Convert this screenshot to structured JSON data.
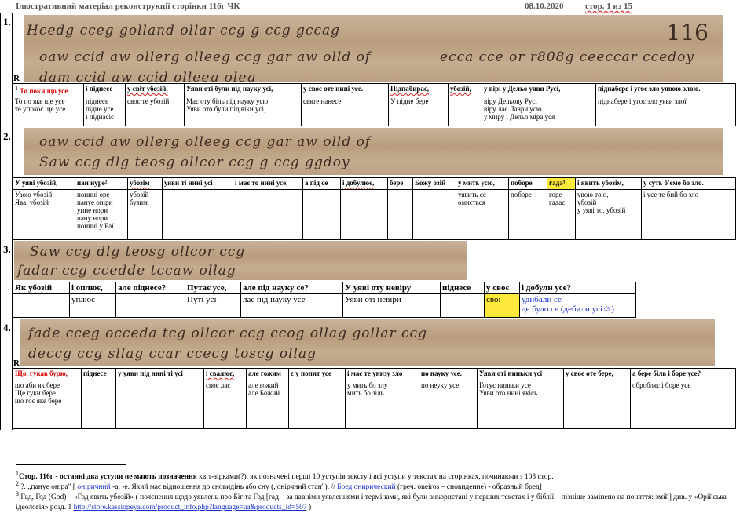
{
  "header": {
    "title": "Ілюстративний матеріал  реконструкції сторінки 116г ЧК",
    "date": "08.10.2020",
    "page": "стор. 1 из 15"
  },
  "section1": {
    "num": "1.",
    "r": "R",
    "ink1": "Hcedg cceg golland ollar ccg g ccg gccag",
    "ink2": "oaw ccid aw ollerg olleeg ccg gar aw olld of",
    "ink3": "dam ccid aw ccid olleeg oleg",
    "pagenum": "116",
    "ink_right": "ecca cce or r808g ceeccar ccedoy",
    "headers": [
      "То поки що усе",
      "і піднесе",
      "у світ убозій,",
      "Уяви оті були під науку усі,",
      "у своє оте нині усе.",
      "Підпабирає,",
      "убозій,",
      "у вірі у Дельо уяви Русі,",
      "піднабере і угоє зло уявою злою."
    ],
    "cells": [
      "То по яке ще усе\nте упокоє ще усе",
      "піднесе\nпідне усе\nі піднасіє",
      "своє те убозій",
      "Має оту біль під науку усю\nУяви ото були під віки усі,",
      "святе нанесе",
      "У підне бере",
      "",
      "віру Дельову Русі\nвіру лає Лаври усю\nу миру і Дельо міра уся",
      "піднабере і угоє зло уяви злої"
    ]
  },
  "section2": {
    "num": "2.",
    "ink1": "oaw ccid aw ollerg olleeg ccg gar aw olld of",
    "ink2": "Saw ccg dlg teosg ollcor ccg g ccg ggdoy",
    "headers": [
      "У уяві убозій,",
      "пан нуре²",
      "убозім",
      "уяви ті нині усі",
      "і має то нині усе,",
      "а під се",
      "і добулює,",
      "бере",
      "Божу озій",
      "у мить усю,",
      "поборе",
      "гада³",
      "і явить убозім,",
      "у суть б'ємо бо зло."
    ],
    "cells": [
      "Увою убозій\nЯва, убозій",
      "понині оре\nпануе оніри\nупне нори\nпану нори\nпонині у Раї",
      "убозій\nбузим",
      "",
      "",
      "",
      "",
      "",
      "",
      "уявить се\nомиється",
      "поборе",
      "горе\nгадає",
      "увою тою,\nубозій\nу уяві то, убозій",
      "і усе те бий бо зло"
    ]
  },
  "section3": {
    "num": "3.",
    "ink1": "Saw ccg dlg teosg ollcor ccg",
    "ink2": "fadar ccg ccedde tccaw ollag",
    "headers": [
      "Як убозій",
      "і оплює,",
      "але піднесе?",
      "Путає усе,",
      "але під науку се?",
      "У уяві оту невіру",
      "піднесе",
      "у своє",
      "і добули усе?"
    ],
    "cells": [
      "",
      "уплює",
      "",
      "Путі усі",
      "лає під науку усе",
      "Уяви оті невіри",
      "",
      "свої",
      "удибали се\nде було се (дебили усі☺)"
    ]
  },
  "section4": {
    "num": "4.",
    "r": "R",
    "ink1": "fade cceg occeda tcg ollcor ccg ccog ollag gollar ccg",
    "ink2": "deccg ccg sllag ccar ccecg toscg ollag",
    "headers": [
      "Що, гукав бурю,",
      "піднесе",
      "у уяви під нині ті усі",
      "і свалює,",
      "але гожим",
      "є у попит усе",
      "і має те унизу зло",
      "по науку усе.",
      "Уяви оті ниньки усі",
      "у своє оте бере,",
      "а бере біль і боре усе?"
    ],
    "cells": [
      "що аби як бере\nЩе гуки бере\nщо гоє яке бере",
      "",
      "",
      "своє лає",
      "але гожий\nале Божий",
      "",
      "у мить бо злу\nмить бо зіль",
      "по неуку усе",
      "Готує ниньки усе\nУяви ото нині якісь",
      "",
      "обробляє і боре усе"
    ]
  },
  "footnotes": {
    "f1_num": "1",
    "f1_bold": "Стор. 116г - останні два уступи не мають позначення",
    "f1_text": " квіт-зірками(?), як позначені перші 10 уступів тексту і всі уступи у текстах на сторінках, починаючи з 103 стор.",
    "f2_num": "2",
    "f2_text_a": " ?. „пануе оніра\" [ ",
    "f2_link1": "онірични́й",
    "f2_text_b": " -а, -е. Який має відношення до сновидінь або сну („онірчний стан\"). // ",
    "f2_link2": "Бред онирический",
    "f2_text_c": "  (греч. oneiros – сновидение) - образный бред]",
    "f3_num": "3",
    "f3_text": " Гад, Год (God) – «Год явить убозій» ( пояснення щодо уявлень про Біг та Год [гад – за давніми уявленнями і термінами, які були використані у перших текстах і у біблії – пізніше замінено на поняття: змій] див. у «Орійська ідеологія» розд. 1 ",
    "f3_url": "http://store.kassiopeya.com/product_info.php?language=ua&products_id=507",
    "f3_tail": " )"
  }
}
